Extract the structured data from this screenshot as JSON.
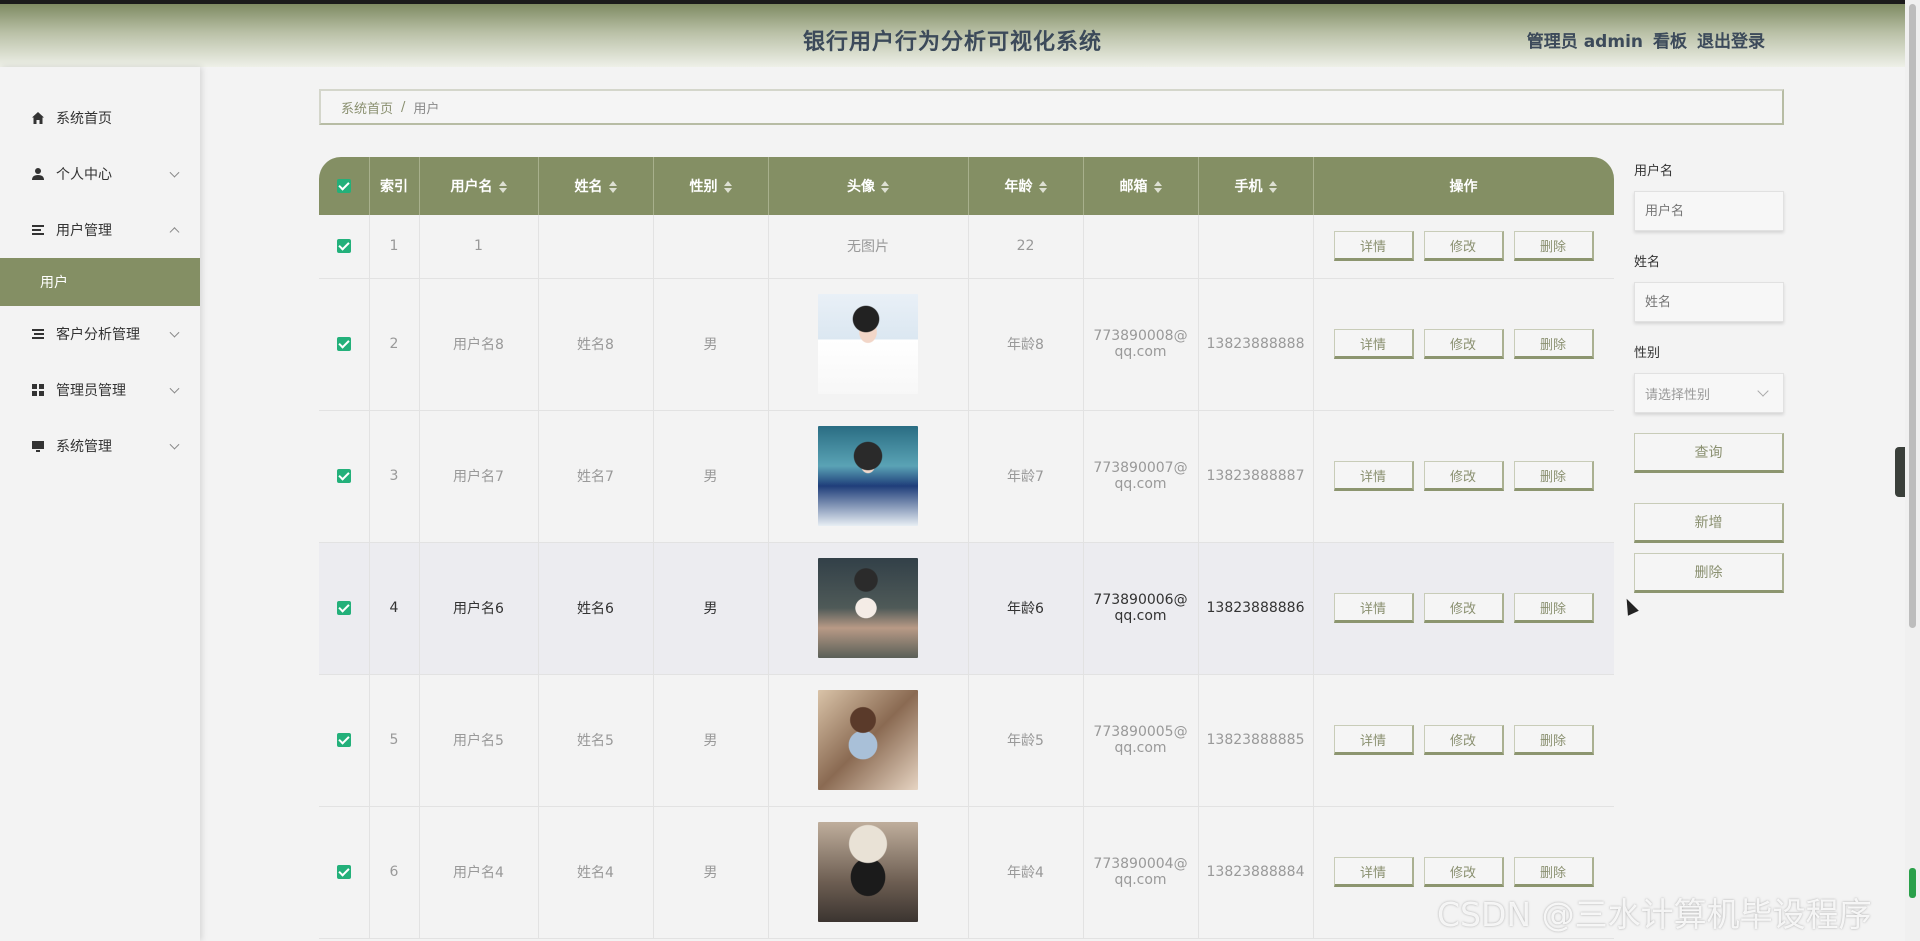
{
  "header": {
    "title": "银行用户行为分析可视化系统",
    "role": "管理员 admin",
    "board": "看板",
    "logout": "退出登录"
  },
  "sidebar": {
    "items": [
      {
        "label": "系统首页",
        "icon": "home-icon"
      },
      {
        "label": "个人中心",
        "icon": "user-icon"
      },
      {
        "label": "用户管理",
        "icon": "list-icon"
      },
      {
        "label": "用户",
        "icon": ""
      },
      {
        "label": "客户分析管理",
        "icon": "list-icon"
      },
      {
        "label": "管理员管理",
        "icon": "grid-icon"
      },
      {
        "label": "系统管理",
        "icon": "monitor-icon"
      }
    ]
  },
  "breadcrumb": {
    "home": "系统首页",
    "sep": "/",
    "current": "用户"
  },
  "table": {
    "headers": [
      "索引",
      "用户名",
      "姓名",
      "性别",
      "头像",
      "年龄",
      "邮箱",
      "手机",
      "操作"
    ],
    "no_image": "无图片",
    "actions": {
      "detail": "详情",
      "edit": "修改",
      "delete": "删除"
    },
    "rows": [
      {
        "index": "1",
        "username": "1",
        "name": "",
        "gender": "",
        "avatar": "",
        "age": "22",
        "email_1": "",
        "email_2": "",
        "phone": ""
      },
      {
        "index": "2",
        "username": "用户名8",
        "name": "姓名8",
        "gender": "男",
        "avatar": "photo",
        "age": "年龄8",
        "email_1": "773890008@",
        "email_2": "qq.com",
        "phone": "13823888888"
      },
      {
        "index": "3",
        "username": "用户名7",
        "name": "姓名7",
        "gender": "男",
        "avatar": "photo",
        "age": "年龄7",
        "email_1": "773890007@",
        "email_2": "qq.com",
        "phone": "13823888887"
      },
      {
        "index": "4",
        "username": "用户名6",
        "name": "姓名6",
        "gender": "男",
        "avatar": "photo",
        "age": "年龄6",
        "email_1": "773890006@",
        "email_2": "qq.com",
        "phone": "13823888886"
      },
      {
        "index": "5",
        "username": "用户名5",
        "name": "姓名5",
        "gender": "男",
        "avatar": "photo",
        "age": "年龄5",
        "email_1": "773890005@",
        "email_2": "qq.com",
        "phone": "13823888885"
      },
      {
        "index": "6",
        "username": "用户名4",
        "name": "姓名4",
        "gender": "男",
        "avatar": "photo",
        "age": "年龄4",
        "email_1": "773890004@",
        "email_2": "qq.com",
        "phone": "13823888884"
      }
    ]
  },
  "search": {
    "username_label": "用户名",
    "username_placeholder": "用户名",
    "name_label": "姓名",
    "name_placeholder": "姓名",
    "gender_label": "性别",
    "gender_placeholder": "请选择性别",
    "query": "查询",
    "add": "新增",
    "delete": "删除"
  },
  "watermark": "CSDN @三水计算机毕设程序",
  "colors": {
    "primary": "#848f64",
    "checkbox": "#23b07a",
    "header_text": "#3c4a5a"
  }
}
